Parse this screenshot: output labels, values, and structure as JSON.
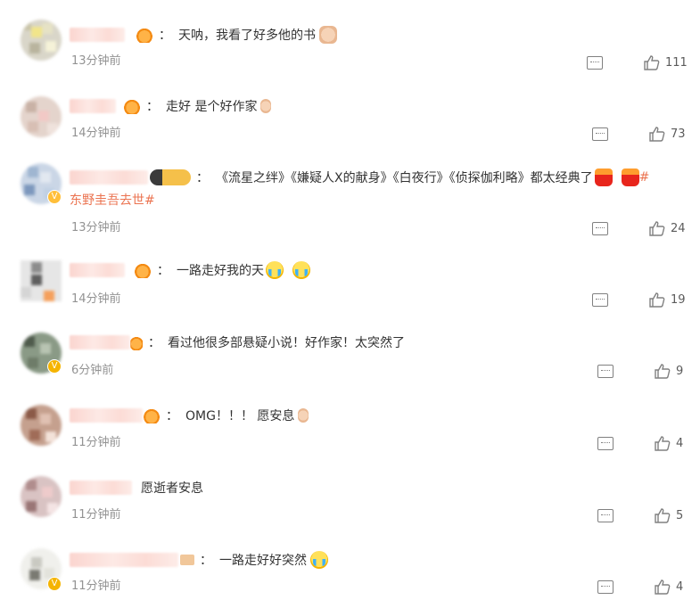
{
  "comments": [
    {
      "text": "天呐，我看了好多他的书",
      "time": "13分钟前",
      "likes": "111",
      "badges": [
        "crown"
      ],
      "emojis": [
        "pray"
      ]
    },
    {
      "text": "走好 是个好作家",
      "time": "14分钟前",
      "likes": "73",
      "badges": [
        "crown"
      ],
      "emojis": [
        "candle-small"
      ]
    },
    {
      "text": "《流星之绊》《嫌疑人X的献身》《白夜行》《侦探伽利略》都太经典了",
      "tag_prefix": "#",
      "tag_line2": "东野圭吾去世#",
      "time": "13分钟前",
      "likes": "24",
      "badges": [
        "level-badge"
      ],
      "emojis": [
        "candle",
        "candle"
      ]
    },
    {
      "text": "一路走好我的天",
      "time": "14分钟前",
      "likes": "19",
      "badges": [
        "crown"
      ],
      "emojis": [
        "cry",
        "cry"
      ]
    },
    {
      "text": "看过他很多部悬疑小说！好作家！太突然了",
      "time": "6分钟前",
      "likes": "9",
      "badges": [
        "crown"
      ],
      "emojis": []
    },
    {
      "text": "OMG！！！ 愿安息",
      "time": "11分钟前",
      "likes": "4",
      "badges": [
        "crown"
      ],
      "emojis": [
        "candle-small"
      ]
    },
    {
      "text": "愿逝者安息",
      "time": "11分钟前",
      "likes": "5",
      "badges": [],
      "emojis": []
    },
    {
      "text": "一路走好好突然",
      "time": "11分钟前",
      "likes": "4",
      "badges": [
        "v-verified"
      ],
      "emojis": [
        "cry"
      ]
    }
  ],
  "colon": "：",
  "colors": {
    "tag": "#eb7350",
    "time": "#939393",
    "text": "#333333",
    "icon": "#808080"
  },
  "icons": {
    "reply": "comment-icon",
    "like": "thumbs-up-icon"
  }
}
